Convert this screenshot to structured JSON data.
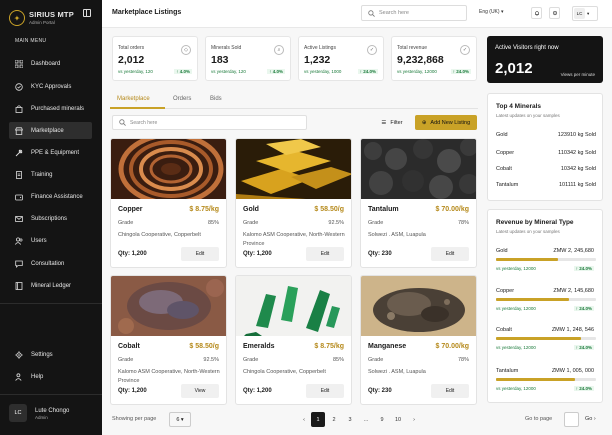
{
  "brand": {
    "name": "SIRIUS MTP",
    "subtitle": "Admin Portal"
  },
  "sidebar": {
    "menu_heading": "MAIN MENU",
    "items": [
      {
        "label": "Dashboard",
        "icon": "grid-icon"
      },
      {
        "label": "KYC Approvals",
        "icon": "badge-check-icon"
      },
      {
        "label": "Purchased minerals",
        "icon": "bag-icon"
      },
      {
        "label": "Marketplace",
        "icon": "store-icon"
      },
      {
        "label": "PPE & Equipment",
        "icon": "tools-icon"
      },
      {
        "label": "Training",
        "icon": "document-icon"
      },
      {
        "label": "Finance Assistance",
        "icon": "wallet-icon"
      },
      {
        "label": "Subscriptions",
        "icon": "mail-icon"
      },
      {
        "label": "Users",
        "icon": "users-icon"
      },
      {
        "label": "Consultation",
        "icon": "chat-icon"
      },
      {
        "label": "Mineral Ledger",
        "icon": "ledger-icon"
      }
    ],
    "bottom": [
      {
        "label": "Settings",
        "icon": "gear-icon"
      },
      {
        "label": "Help",
        "icon": "help-icon"
      }
    ],
    "user": {
      "initials": "LC",
      "name": "Lute Chongo",
      "role": "Admin"
    }
  },
  "topbar": {
    "title": "Marketplace Listings",
    "search_placeholder": "Search here",
    "language": "Eng (UK)",
    "avatar_initials": "LC"
  },
  "stats": [
    {
      "label": "Total orders",
      "value": "2,012",
      "compare": "vs yesterday, 120",
      "delta": "↑ 4.0%"
    },
    {
      "label": "Minerals Sold",
      "value": "183",
      "compare": "vs yesterday, 120",
      "delta": "↑ 4.0%"
    },
    {
      "label": "Active Listings",
      "value": "1,232",
      "compare": "vs yesterday, 1000",
      "delta": "↑ 24.0%"
    },
    {
      "label": "Total revenue",
      "value": "9,232,868",
      "compare": "vs yesterday, 12000",
      "delta": "↑ 24.0%"
    }
  ],
  "tabs": [
    "Marketplace",
    "Orders",
    "Bids"
  ],
  "listing": {
    "search_placeholder": "Search here",
    "filter_label": "Filter",
    "new_listing_label": "Add New Listing"
  },
  "cards": [
    {
      "name": "Copper",
      "price": "$ 8.75/kg",
      "grade_label": "Grade",
      "grade": "85%",
      "location": "Chingola Cooperative, Copperbelt",
      "qty": "Qty: 1,200",
      "action": "Edit"
    },
    {
      "name": "Gold",
      "price": "$ 58.50/g",
      "grade_label": "Grade",
      "grade": "92.5%",
      "location": "Kalomo ASM Cooperative, North-Western Province",
      "qty": "Qty: 1,200",
      "action": "Edit"
    },
    {
      "name": "Tantalum",
      "price": "$ 70.00/kg",
      "grade_label": "Grade",
      "grade": "78%",
      "location": "Solwezi . ASM, Luapula",
      "qty": "Qty: 230",
      "action": "Edit"
    },
    {
      "name": "Cobalt",
      "price": "$ 58.50/g",
      "grade_label": "Grade",
      "grade": "92.5%",
      "location": "Kalomo ASM Cooperative, North-Western Province",
      "qty": "Qty: 1,200",
      "action": "View"
    },
    {
      "name": "Emeralds",
      "price": "$ 8.75/kg",
      "grade_label": "Grade",
      "grade": "85%",
      "location": "Chingola Cooperative, Copperbelt",
      "qty": "Qty: 1,200",
      "action": "Edit"
    },
    {
      "name": "Manganese",
      "price": "$ 70.00/kg",
      "grade_label": "Grade",
      "grade": "78%",
      "location": "Solwezi . ASM, Luapula",
      "qty": "Qty: 230",
      "action": "Edit"
    }
  ],
  "pagination": {
    "per_page_label": "Showing per page",
    "per_page": "6",
    "pages": [
      "1",
      "2",
      "3",
      "...",
      "9",
      "10"
    ],
    "goto_label": "Go to page",
    "go_label": "Go"
  },
  "visitors": {
    "title": "Active Visitors right now",
    "value": "2,012",
    "unit": "Views per minute"
  },
  "top_minerals": {
    "title": "Top 4 Minerals",
    "subtitle": "Latest updates on your samples",
    "rows": [
      {
        "name": "Gold",
        "value": "123910 kg Sold"
      },
      {
        "name": "Copper",
        "value": "110342 kg Sold"
      },
      {
        "name": "Cobalt",
        "value": "10342 kg Sold"
      },
      {
        "name": "Tantalum",
        "value": "101111 kg Sold"
      }
    ]
  },
  "revenue": {
    "title": "Revenue by Mineral Type",
    "subtitle": "Latest updates on your samples",
    "rows": [
      {
        "name": "Gold",
        "value": "ZMW 2, 245,680",
        "compare": "vs yesterday, 12000",
        "delta": "↑ 24.0%",
        "fill": 0.62
      },
      {
        "name": "Copper",
        "value": "ZMW 2, 145,680",
        "compare": "vs yesterday, 12000",
        "delta": "↑ 24.0%",
        "fill": 0.73
      },
      {
        "name": "Cobalt",
        "value": "ZMW 1, 248, 546",
        "compare": "vs yesterday, 12000",
        "delta": "↑ 24.0%",
        "fill": 0.85
      },
      {
        "name": "Tantalum",
        "value": "ZMW 1, 005, 000",
        "compare": "vs yesterday, 12000",
        "delta": "↑ 24.0%",
        "fill": 0.79
      }
    ]
  },
  "colors": {
    "accent": "#c9a227",
    "sidebar_bg": "#141414",
    "positive": "#1a7a3a"
  }
}
